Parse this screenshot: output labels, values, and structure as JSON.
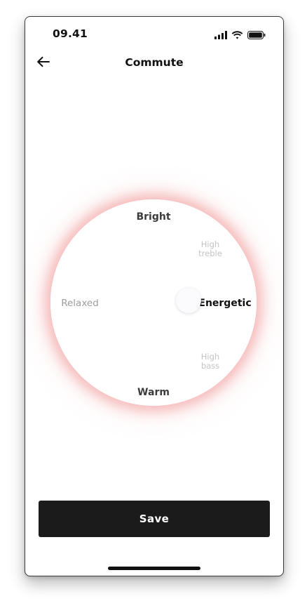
{
  "status_bar": {
    "time": "09.41",
    "icons": [
      "cellular-signal-icon",
      "wifi-icon",
      "battery-icon"
    ]
  },
  "header": {
    "back_icon": "arrow-left-icon",
    "title": "Commute"
  },
  "sound_wheel": {
    "top_label": "Bright",
    "bottom_label": "Warm",
    "left_label": "Relaxed",
    "right_label": "Energetic",
    "upper_right_label": "High\ntreble",
    "lower_right_label": "High\nbass",
    "selected": "Energetic",
    "glow_color": "#ef7878"
  },
  "actions": {
    "save_label": "Save"
  },
  "colors": {
    "primary_button": "#1c1b1c",
    "text": "#111111"
  }
}
